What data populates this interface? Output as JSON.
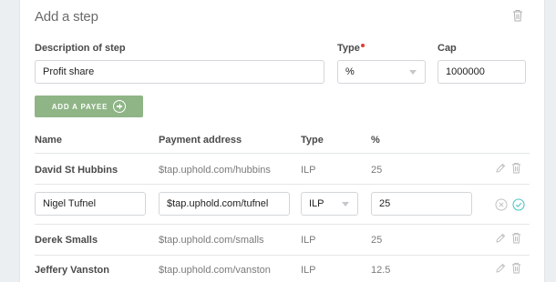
{
  "step": {
    "title": "Add a step",
    "description_label": "Description of step",
    "description_value": "Profit share",
    "type_label": "Type",
    "type_value": "%",
    "cap_label": "Cap",
    "cap_value": "1000000",
    "add_payee_label": "ADD A PAYEE"
  },
  "payees": {
    "headers": [
      "Name",
      "Payment address",
      "Type",
      "%"
    ],
    "rows": [
      {
        "name": "David St Hubbins",
        "address": "$tap.uphold.com/hubbins",
        "type": "ILP",
        "percent": "25"
      },
      {
        "name": "Derek Smalls",
        "address": "$tap.uphold.com/smalls",
        "type": "ILP",
        "percent": "25"
      },
      {
        "name": "Jeffery Vanston",
        "address": "$tap.uphold.com/vanston",
        "type": "ILP",
        "percent": "12.5"
      }
    ],
    "edit_row": {
      "name": "Nigel Tufnel",
      "address": "$tap.uphold.com/tufnel",
      "type": "ILP",
      "percent": "25"
    }
  },
  "colors": {
    "accent_green": "#8fb587",
    "confirm_teal": "#4ec3c3",
    "required_red": "#e53935"
  }
}
